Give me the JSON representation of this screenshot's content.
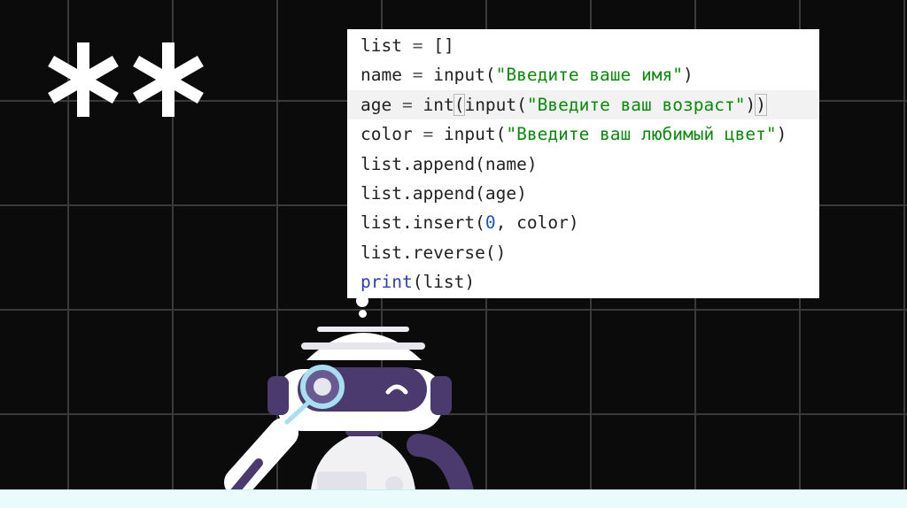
{
  "code": {
    "lines": [
      [
        {
          "t": "list",
          "c": "id"
        },
        {
          "t": " = ",
          "c": "op"
        },
        {
          "t": "[]",
          "c": "id"
        }
      ],
      [
        {
          "t": "name",
          "c": "id"
        },
        {
          "t": " = ",
          "c": "op"
        },
        {
          "t": "input",
          "c": "id"
        },
        {
          "t": "(",
          "c": "id"
        },
        {
          "t": "\"Введите ваше имя\"",
          "c": "str"
        },
        {
          "t": ")",
          "c": "id"
        }
      ],
      [
        {
          "t": "age",
          "c": "id"
        },
        {
          "t": " = ",
          "c": "op"
        },
        {
          "t": "int",
          "c": "id"
        },
        {
          "t": "(",
          "c": "paren"
        },
        {
          "t": "input",
          "c": "id"
        },
        {
          "t": "(",
          "c": "id"
        },
        {
          "t": "\"Введите ваш возраст\"",
          "c": "str"
        },
        {
          "t": ")",
          "c": "id"
        },
        {
          "t": ")",
          "c": "paren"
        }
      ],
      [
        {
          "t": "color",
          "c": "id"
        },
        {
          "t": " = ",
          "c": "op"
        },
        {
          "t": "input",
          "c": "id"
        },
        {
          "t": "(",
          "c": "id"
        },
        {
          "t": "\"Введите ваш любимый цвет\"",
          "c": "str"
        },
        {
          "t": ")",
          "c": "id"
        }
      ],
      [
        {
          "t": "list.append",
          "c": "id"
        },
        {
          "t": "(name)",
          "c": "id"
        }
      ],
      [
        {
          "t": "list.append",
          "c": "id"
        },
        {
          "t": "(age)",
          "c": "id"
        }
      ],
      [
        {
          "t": "list.insert",
          "c": "id"
        },
        {
          "t": "(",
          "c": "id"
        },
        {
          "t": "0",
          "c": "num"
        },
        {
          "t": ", color)",
          "c": "id"
        }
      ],
      [
        {
          "t": "list.reverse",
          "c": "id"
        },
        {
          "t": "()",
          "c": "id"
        }
      ],
      [
        {
          "t": "print",
          "c": "kw"
        },
        {
          "t": "(list)",
          "c": "id"
        }
      ]
    ],
    "highlighted_line": 2
  },
  "colors": {
    "background": "#0b0b0c",
    "grid_line": "#3a3a3a",
    "string": "#0a8a0a",
    "number": "#1a55c0",
    "keyword": "#2b3fb0",
    "robot_accent": "#4a3a6e",
    "magnifier": "#a8dff0",
    "floor": "#e9fbfb"
  },
  "icons": {
    "decoration": "double-asterisk-icon",
    "mascot": "robot-with-magnifier-illustration",
    "thought": "thought-bubble-dots-icon"
  }
}
